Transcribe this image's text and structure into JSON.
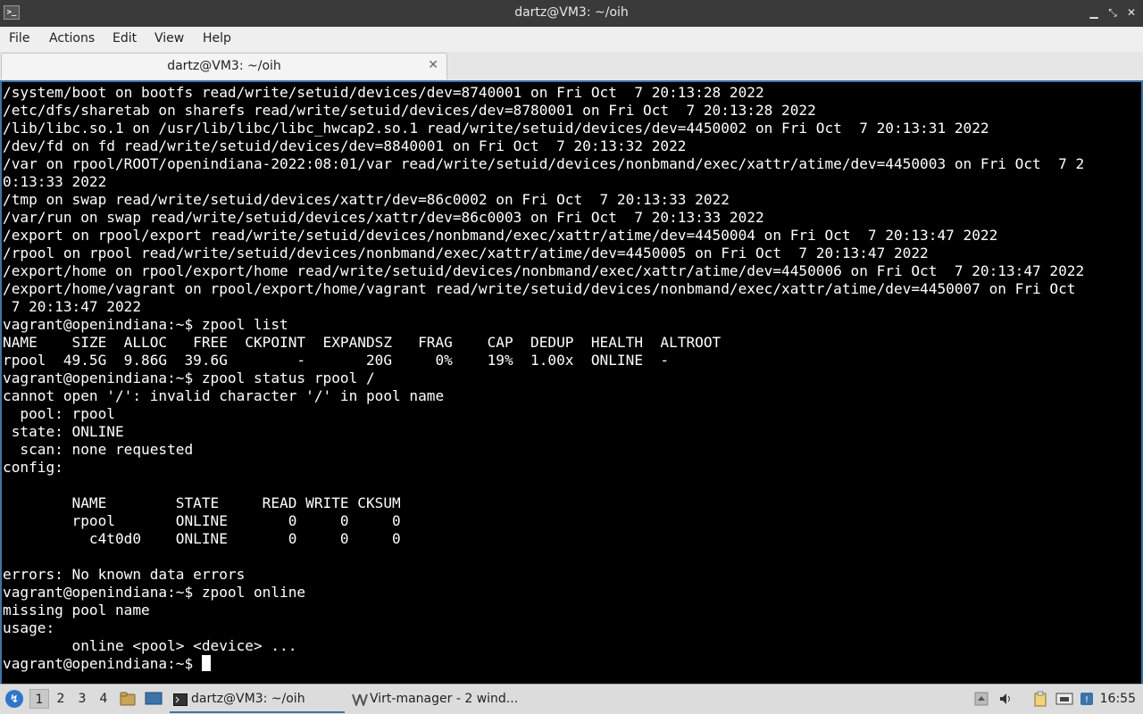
{
  "window": {
    "title": "dartz@VM3: ~/oih",
    "minimize_glyph": "▁",
    "restore_glyph": "⤡",
    "close_glyph": "✕"
  },
  "menu": {
    "file": "File",
    "actions": "Actions",
    "edit": "Edit",
    "view": "View",
    "help": "Help"
  },
  "tab": {
    "label": "dartz@VM3: ~/oih",
    "close_glyph": "✕"
  },
  "terminal": {
    "lines": [
      "/system/boot on bootfs read/write/setuid/devices/dev=8740001 on Fri Oct  7 20:13:28 2022",
      "/etc/dfs/sharetab on sharefs read/write/setuid/devices/dev=8780001 on Fri Oct  7 20:13:28 2022",
      "/lib/libc.so.1 on /usr/lib/libc/libc_hwcap2.so.1 read/write/setuid/devices/dev=4450002 on Fri Oct  7 20:13:31 2022",
      "/dev/fd on fd read/write/setuid/devices/dev=8840001 on Fri Oct  7 20:13:32 2022",
      "/var on rpool/ROOT/openindiana-2022:08:01/var read/write/setuid/devices/nonbmand/exec/xattr/atime/dev=4450003 on Fri Oct  7 2",
      "0:13:33 2022",
      "/tmp on swap read/write/setuid/devices/xattr/dev=86c0002 on Fri Oct  7 20:13:33 2022",
      "/var/run on swap read/write/setuid/devices/xattr/dev=86c0003 on Fri Oct  7 20:13:33 2022",
      "/export on rpool/export read/write/setuid/devices/nonbmand/exec/xattr/atime/dev=4450004 on Fri Oct  7 20:13:47 2022",
      "/rpool on rpool read/write/setuid/devices/nonbmand/exec/xattr/atime/dev=4450005 on Fri Oct  7 20:13:47 2022",
      "/export/home on rpool/export/home read/write/setuid/devices/nonbmand/exec/xattr/atime/dev=4450006 on Fri Oct  7 20:13:47 2022",
      "/export/home/vagrant on rpool/export/home/vagrant read/write/setuid/devices/nonbmand/exec/xattr/atime/dev=4450007 on Fri Oct",
      " 7 20:13:47 2022",
      "vagrant@openindiana:~$ zpool list",
      "NAME    SIZE  ALLOC   FREE  CKPOINT  EXPANDSZ   FRAG    CAP  DEDUP  HEALTH  ALTROOT",
      "rpool  49.5G  9.86G  39.6G        -       20G     0%    19%  1.00x  ONLINE  -",
      "vagrant@openindiana:~$ zpool status rpool /",
      "cannot open '/': invalid character '/' in pool name",
      "  pool: rpool",
      " state: ONLINE",
      "  scan: none requested",
      "config:",
      "",
      "        NAME        STATE     READ WRITE CKSUM",
      "        rpool       ONLINE       0     0     0",
      "          c4t0d0    ONLINE       0     0     0",
      "",
      "errors: No known data errors",
      "vagrant@openindiana:~$ zpool online",
      "missing pool name",
      "usage:",
      "        online <pool> <device> ..."
    ],
    "prompt": "vagrant@openindiana:~$ "
  },
  "taskbar": {
    "workspaces": [
      "1",
      "2",
      "3",
      "4"
    ],
    "tasks": [
      {
        "label": "dartz@VM3: ~/oih",
        "icon": "terminal-icon"
      },
      {
        "label": "Virt-manager - 2 wind...",
        "icon": "virt-manager-icon"
      }
    ],
    "clock": "16:55"
  }
}
